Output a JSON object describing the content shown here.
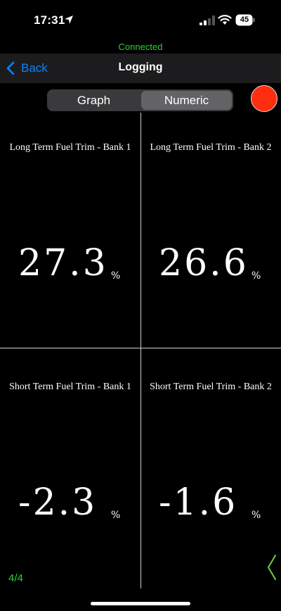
{
  "status": {
    "time": "17:31",
    "battery": "45"
  },
  "connection": {
    "status": "Connected"
  },
  "nav": {
    "back_label": "Back",
    "title": "Logging"
  },
  "segments": {
    "graph": "Graph",
    "numeric": "Numeric",
    "selected": "Numeric"
  },
  "cells": [
    {
      "title": "Long Term Fuel Trim - Bank 1",
      "value": "27.3",
      "unit": "%"
    },
    {
      "title": "Long Term Fuel Trim - Bank 2",
      "value": "26.6",
      "unit": "%"
    },
    {
      "title": "Short Term Fuel Trim - Bank 1",
      "value": "-2.3",
      "unit": "%"
    },
    {
      "title": "Short Term Fuel Trim - Bank 2",
      "value": "-1.6",
      "unit": "%"
    }
  ],
  "page_indicator": "4/4",
  "colors": {
    "accent": "#0a84ff",
    "connected": "#2fd12f",
    "record": "#ff2d10"
  }
}
